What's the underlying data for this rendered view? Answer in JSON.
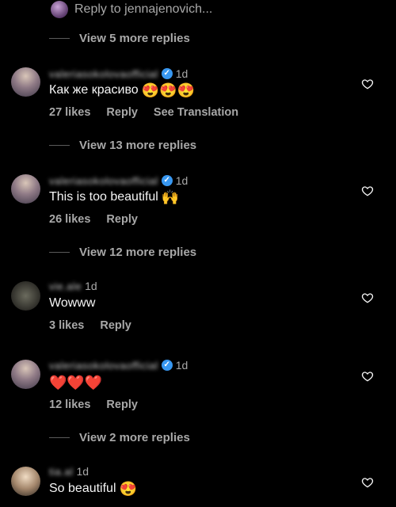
{
  "reply_to": {
    "label": "Reply to jennajenovich..."
  },
  "view_replies": [
    {
      "label": "View 5 more replies"
    },
    {
      "label": "View 13 more replies"
    },
    {
      "label": "View 12 more replies"
    },
    {
      "label": "View 2 more replies"
    }
  ],
  "comments": [
    {
      "username": "valeriasokolovaofficial",
      "verified": true,
      "time": "1d",
      "text": "Как же красиво",
      "emoji": "😍😍😍",
      "likes": "27 likes",
      "reply": "Reply",
      "translate": "See Translation"
    },
    {
      "username": "valeriasokolovaofficial",
      "verified": true,
      "time": "1d",
      "text": "This is too beautiful",
      "emoji": "🙌",
      "likes": "26 likes",
      "reply": "Reply"
    },
    {
      "username": "vie.ale",
      "verified": false,
      "time": "1d",
      "text": "Wowww",
      "emoji": "",
      "likes": "3 likes",
      "reply": "Reply"
    },
    {
      "username": "valeriasokolovaofficial",
      "verified": true,
      "time": "1d",
      "text": "",
      "emoji": "❤️❤️❤️",
      "likes": "12 likes",
      "reply": "Reply"
    },
    {
      "username": "tia.al",
      "verified": false,
      "time": "1d",
      "text": "So beautiful",
      "emoji": "😍",
      "likes": "",
      "reply": ""
    }
  ],
  "icons": {
    "like": "heart-outline-icon",
    "verified": "verified-badge-icon"
  },
  "colors": {
    "background": "#000000",
    "text": "#f5f5f5",
    "secondary": "#a8a8a8",
    "verified": "#3897f0",
    "heart_emoji": "#e0245e"
  }
}
